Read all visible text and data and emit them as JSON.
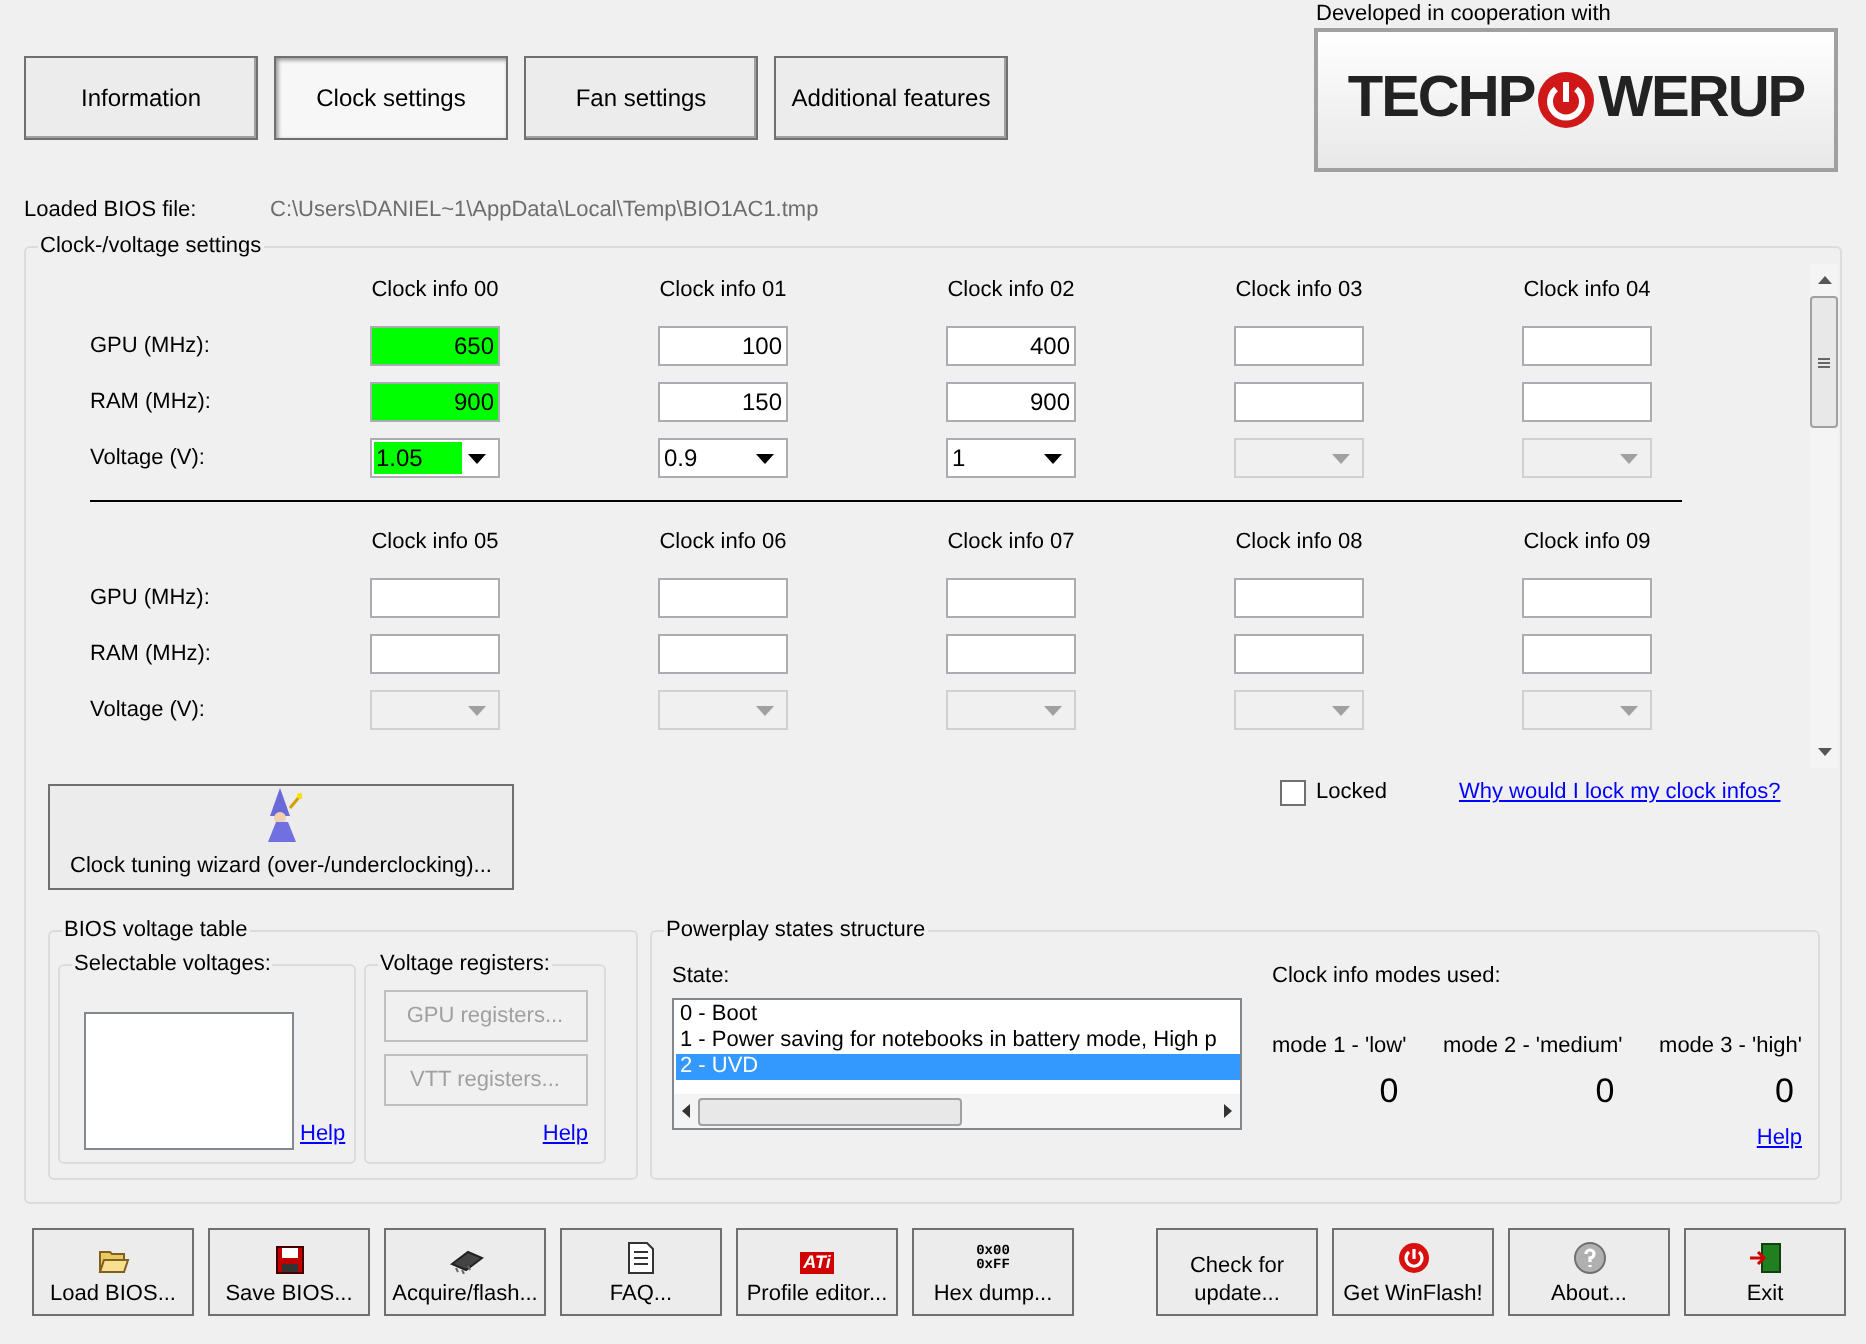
{
  "tabs": [
    {
      "label": "Information",
      "selected": false
    },
    {
      "label": "Clock settings",
      "selected": true
    },
    {
      "label": "Fan settings",
      "selected": false
    },
    {
      "label": "Additional features",
      "selected": false
    }
  ],
  "logo": {
    "caption": "Developed in cooperation with",
    "left": "TECHP",
    "right": "WERUP"
  },
  "bios_file": {
    "label": "Loaded BIOS file:",
    "path": "C:\\Users\\DANIEL~1\\AppData\\Local\\Temp\\BIO1AC1.tmp"
  },
  "clock_group": {
    "title": "Clock-/voltage settings",
    "blocks": [
      {
        "labels": [
          "GPU (MHz):",
          "RAM (MHz):",
          "Voltage (V):"
        ],
        "columns": [
          {
            "header": "Clock info 00",
            "gpu": "650",
            "ram": "900",
            "voltage": "1.05",
            "active": true,
            "disabled": false
          },
          {
            "header": "Clock info 01",
            "gpu": "100",
            "ram": "150",
            "voltage": "0.9",
            "active": false,
            "disabled": false
          },
          {
            "header": "Clock info 02",
            "gpu": "400",
            "ram": "900",
            "voltage": "1",
            "active": false,
            "disabled": false
          },
          {
            "header": "Clock info 03",
            "active": false,
            "disabled": true
          },
          {
            "header": "Clock info 04",
            "active": false,
            "disabled": true
          }
        ]
      },
      {
        "labels": [
          "GPU (MHz):",
          "RAM (MHz):",
          "Voltage (V):"
        ],
        "columns": [
          {
            "header": "Clock info 05",
            "active": false,
            "disabled": true
          },
          {
            "header": "Clock info 06",
            "active": false,
            "disabled": true
          },
          {
            "header": "Clock info 07",
            "active": false,
            "disabled": true
          },
          {
            "header": "Clock info 08",
            "active": false,
            "disabled": true
          },
          {
            "header": "Clock info 09",
            "active": false,
            "disabled": true
          }
        ]
      }
    ],
    "locked": {
      "label": "Locked",
      "checked": false
    },
    "lock_link": "Why would I lock my clock infos?",
    "wizard_button": "Clock tuning wizard (over-/underclocking)..."
  },
  "voltage_table": {
    "title": "BIOS voltage table",
    "selectable_label": "Selectable voltages:",
    "help": "Help",
    "registers_label": "Voltage registers:",
    "buttons": [
      {
        "label": "GPU registers...",
        "disabled": true
      },
      {
        "label": "VTT registers...",
        "disabled": true
      }
    ],
    "registers_help": "Help"
  },
  "powerplay": {
    "title": "Powerplay states structure",
    "state_label": "State:",
    "states": [
      {
        "label": "0 - Boot",
        "selected": false
      },
      {
        "label": "1 - Power saving for notebooks in battery mode, High p",
        "selected": false
      },
      {
        "label": "2 - UVD",
        "selected": true
      }
    ],
    "modes_title": "Clock info modes used:",
    "modes": [
      {
        "label": "mode 1 - 'low'",
        "value": "0"
      },
      {
        "label": "mode 2 - 'medium'",
        "value": "0"
      },
      {
        "label": "mode 3 - 'high'",
        "value": "0"
      }
    ],
    "help": "Help"
  },
  "bottom_buttons": [
    {
      "label": "Load BIOS...",
      "kind": "folder"
    },
    {
      "label": "Save BIOS...",
      "kind": "floppy"
    },
    {
      "label": "Acquire/flash...",
      "kind": "chip"
    },
    {
      "label": "FAQ...",
      "kind": "document"
    },
    {
      "label": "Profile editor...",
      "kind": "ati",
      "icon_text": "ATi"
    },
    {
      "label": "Hex dump...",
      "kind": "hex",
      "icon_text": "0x00 0xFF"
    },
    {
      "label": "Check for update...",
      "kind": "text"
    },
    {
      "label": "Get WinFlash!",
      "kind": "power"
    },
    {
      "label": "About...",
      "kind": "help"
    },
    {
      "label": "Exit",
      "kind": "exit"
    }
  ]
}
